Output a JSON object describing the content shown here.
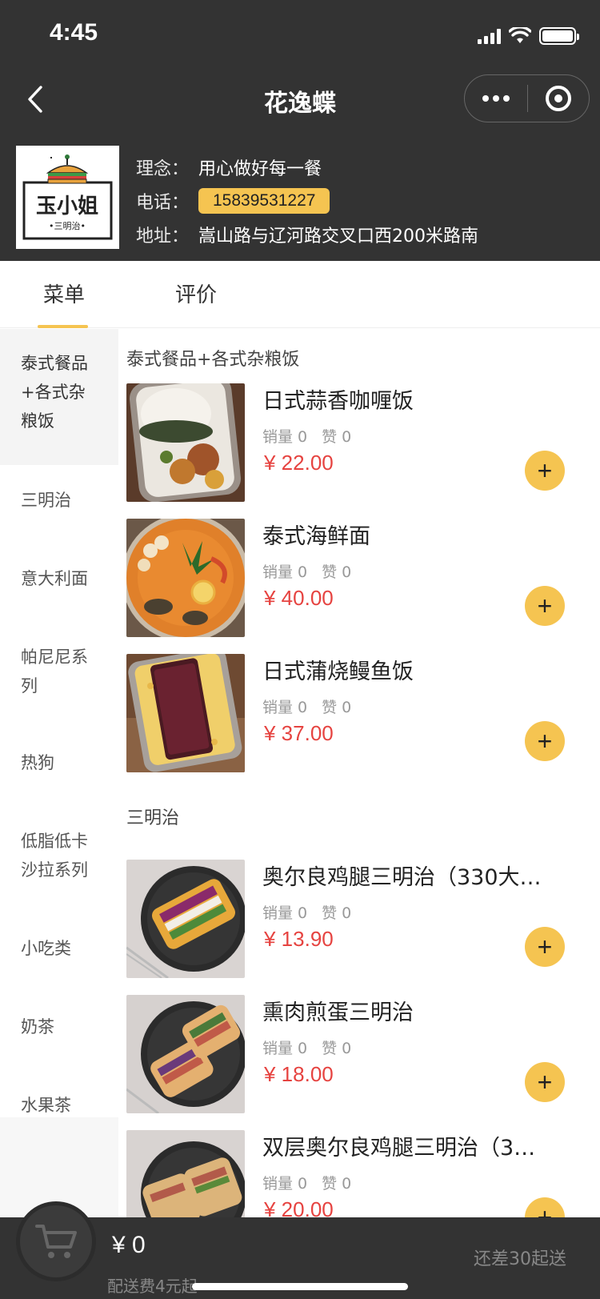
{
  "status_bar": {
    "time": "4:45"
  },
  "nav": {
    "title": "花逸蝶"
  },
  "shop": {
    "logo_text": "玉小姐",
    "logo_sub": "•三明治•",
    "rows": [
      {
        "label": "理念：",
        "value": "用心做好每一餐"
      },
      {
        "label": "电话：",
        "value": "15839531227"
      },
      {
        "label": "地址：",
        "value": "嵩山路与辽河路交叉口西200米路南"
      }
    ]
  },
  "tabs": [
    {
      "label": "菜单",
      "active": true
    },
    {
      "label": "评价",
      "active": false
    }
  ],
  "categories": [
    {
      "label": "泰式餐品+各式杂粮饭",
      "lines": [
        "泰式餐品",
        "+各式杂",
        "粮饭"
      ],
      "active": true
    },
    {
      "label": "三明治",
      "lines": [
        "三明治"
      ]
    },
    {
      "label": "意大利面",
      "lines": [
        "意大利面"
      ]
    },
    {
      "label": "帕尼尼系列",
      "lines": [
        "帕尼尼系",
        "列"
      ]
    },
    {
      "label": "热狗",
      "lines": [
        "热狗"
      ]
    },
    {
      "label": "低脂低卡沙拉系列",
      "lines": [
        "低脂低卡",
        "沙拉系列"
      ]
    },
    {
      "label": "小吃类",
      "lines": [
        "小吃类"
      ]
    },
    {
      "label": "奶茶",
      "lines": [
        "奶茶"
      ]
    },
    {
      "label": "水果茶",
      "lines": [
        "水果茶"
      ]
    }
  ],
  "sections": [
    {
      "title": "泰式餐品+各式杂粮饭",
      "items": [
        {
          "name": "日式蒜香咖喱饭",
          "sales": "销量 0",
          "likes": "赞 0",
          "price": "¥ 22.00",
          "thumb": "curry-rice"
        },
        {
          "name": "泰式海鲜面",
          "sales": "销量 0",
          "likes": "赞 0",
          "price": "¥ 40.00",
          "thumb": "seafood-noodle"
        },
        {
          "name": "日式蒲烧鳗鱼饭",
          "sales": "销量 0",
          "likes": "赞 0",
          "price": "¥ 37.00",
          "thumb": "eel-rice"
        }
      ]
    },
    {
      "title": "三明治",
      "items": [
        {
          "name": "奥尔良鸡腿三明治（330大…",
          "sales": "销量 0",
          "likes": "赞 0",
          "price": "¥ 13.90",
          "thumb": "sandwich"
        },
        {
          "name": "熏肉煎蛋三明治",
          "sales": "销量 0",
          "likes": "赞 0",
          "price": "¥ 18.00",
          "thumb": "sandwich"
        },
        {
          "name": "双层奥尔良鸡腿三明治（3…",
          "sales": "销量 0",
          "likes": "赞 0",
          "price": "¥ 20.00",
          "thumb": "sandwich"
        }
      ]
    }
  ],
  "add_label": "+",
  "cart": {
    "total": "¥ 0",
    "delivery_fee": "配送费4元起",
    "min_order": "还差30起送"
  },
  "colors": {
    "accent": "#f5c451",
    "price": "#e64340",
    "header_bg": "#333333"
  }
}
